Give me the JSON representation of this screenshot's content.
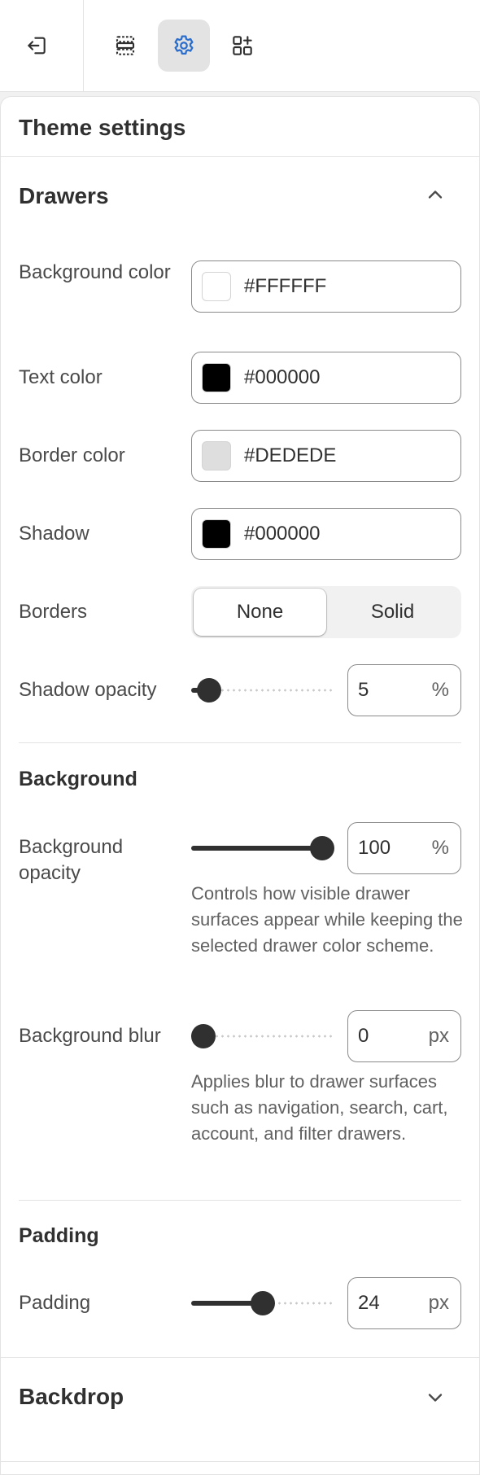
{
  "toolbar": {
    "exit_icon": "exit-icon",
    "sections_icon": "sections-icon",
    "settings_icon": "gear-icon",
    "apps_icon": "apps-add-icon",
    "active": "settings"
  },
  "panel": {
    "title": "Theme settings"
  },
  "drawers": {
    "title": "Drawers",
    "expanded": true,
    "colors": [
      {
        "label": "Background color",
        "hex": "#FFFFFF",
        "swatch": "#FFFFFF"
      },
      {
        "label": "Text color",
        "hex": "#000000",
        "swatch": "#000000"
      },
      {
        "label": "Border color",
        "hex": "#DEDEDE",
        "swatch": "#DEDEDE"
      },
      {
        "label": "Shadow",
        "hex": "#000000",
        "swatch": "#000000"
      }
    ],
    "borders": {
      "label": "Borders",
      "options": [
        "None",
        "Solid"
      ],
      "selected": "None"
    },
    "shadow_opacity": {
      "label": "Shadow opacity",
      "value": "5",
      "unit": "%",
      "fraction": 0.05
    }
  },
  "background": {
    "title": "Background",
    "opacity": {
      "label": "Background opacity",
      "value": "100",
      "unit": "%",
      "fraction": 1.0,
      "help": "Controls how visible drawer surfaces appear while keeping the selected drawer color scheme."
    },
    "blur": {
      "label": "Background blur",
      "value": "0",
      "unit": "px",
      "fraction": 0.0,
      "help": "Applies blur to drawer surfaces such as navigation, search, cart, account, and filter drawers."
    }
  },
  "padding": {
    "title": "Padding",
    "control": {
      "label": "Padding",
      "value": "24",
      "unit": "px",
      "fraction": 0.5
    }
  },
  "backdrop": {
    "title": "Backdrop",
    "expanded": false
  },
  "colors": {
    "accent": "#2c6ecb",
    "text": "#303030",
    "border": "#8a8a8a"
  }
}
